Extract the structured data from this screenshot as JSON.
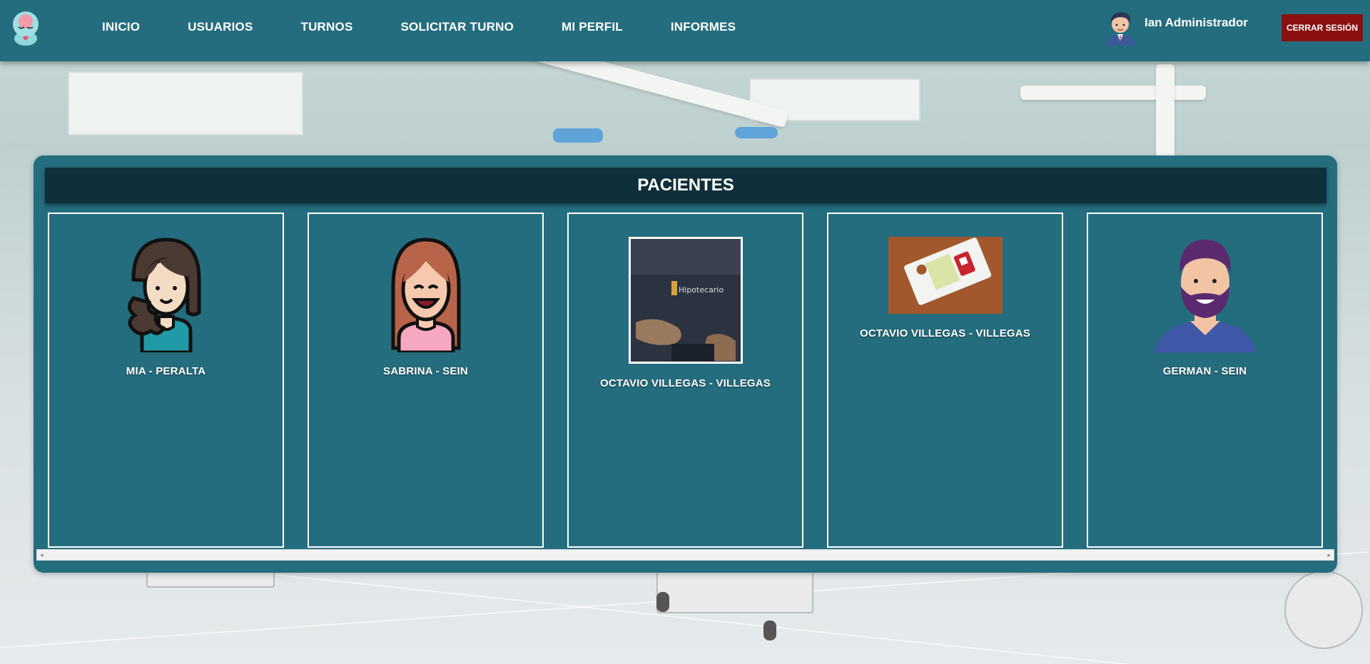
{
  "nav": {
    "items": [
      {
        "label": "INICIO"
      },
      {
        "label": "USUARIOS"
      },
      {
        "label": "TURNOS"
      },
      {
        "label": "SOLICITAR TURNO"
      },
      {
        "label": "MI PERFIL"
      },
      {
        "label": "INFORMES"
      }
    ],
    "user_name": "Ian Administrador",
    "logout_label": "CERRAR SESIÓN"
  },
  "panel": {
    "title": "PACIENTES",
    "patients": [
      {
        "name": "MIA - PERALTA",
        "avatar": "woman-wavy-hair-icon"
      },
      {
        "name": "SABRINA - SEIN",
        "avatar": "woman-smiling-icon"
      },
      {
        "name": "OCTAVIO VILLEGAS - VILLEGAS",
        "avatar": "photo-shirt"
      },
      {
        "name": "OCTAVIO VILLEGAS - VILLEGAS",
        "avatar": "photo-flyer"
      },
      {
        "name": "GERMAN - SEIN",
        "avatar": "man-bearded-icon"
      }
    ]
  },
  "colors": {
    "navbar": "#246d7e",
    "panel": "#246d7e",
    "header": "#0f2f3a",
    "logout": "#8a1010"
  }
}
